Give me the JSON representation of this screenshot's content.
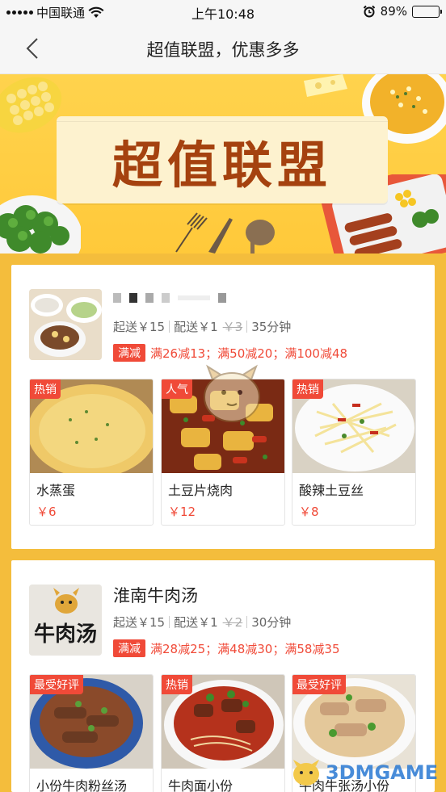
{
  "status_bar": {
    "carrier": "中国联通",
    "time": "上午10:48",
    "battery": "89%",
    "battery_level": 0.89
  },
  "nav": {
    "title": "超值联盟，优惠多多"
  },
  "banner": {
    "title": "超值联盟"
  },
  "shops": [
    {
      "name": "",
      "min_order": "起送￥15",
      "delivery_fee": "配送￥1",
      "original_fee": "￥3",
      "time": "35分钟",
      "promo_tag": "满减",
      "promos": "满26减13；满50减20；满100减48",
      "dishes": [
        {
          "badge": "热销",
          "name": "水蒸蛋",
          "price": "￥6"
        },
        {
          "badge": "人气",
          "name": "土豆片烧肉",
          "price": "￥12"
        },
        {
          "badge": "热销",
          "name": "酸辣土豆丝",
          "price": "￥8"
        }
      ]
    },
    {
      "name": "淮南牛肉汤",
      "min_order": "起送￥15",
      "delivery_fee": "配送￥1",
      "original_fee": "￥2",
      "time": "30分钟",
      "promo_tag": "满减",
      "promos": "满28减25；满48减30；满58减35",
      "thumb_text": "牛肉汤",
      "dishes": [
        {
          "badge": "最受好评",
          "name": "小份牛肉粉丝汤",
          "price": ""
        },
        {
          "badge": "热销",
          "name": "牛肉面小份",
          "price": ""
        },
        {
          "badge": "最受好评",
          "name": "牛肉牛张汤小份",
          "price": ""
        }
      ]
    }
  ],
  "watermark": {
    "text": "3DMGAME"
  },
  "colors": {
    "accent": "#f04a38",
    "background": "#f4bd3c",
    "banner": "#ffc93a",
    "banner_title": "#a5420f"
  }
}
